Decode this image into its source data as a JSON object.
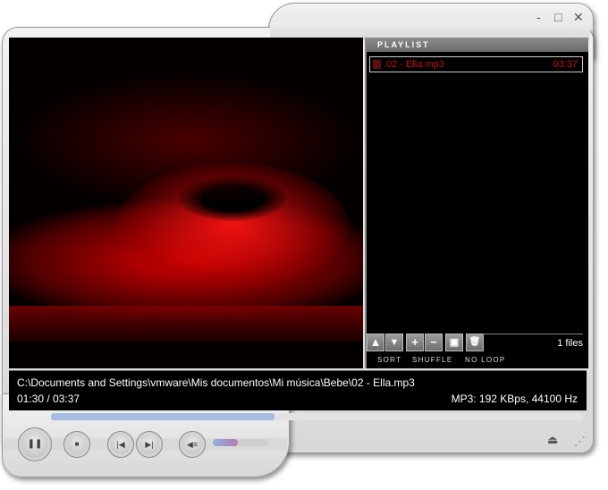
{
  "window": {
    "minimize_icon": "-",
    "maximize_icon": "□",
    "close_icon": "✕"
  },
  "playlist": {
    "title": "PLAYLIST",
    "items": [
      {
        "name": "02 - Ella.mp3",
        "duration": "03:37"
      }
    ],
    "toolbar": {
      "up": "▲",
      "down": "▼",
      "add": "+",
      "remove": "−",
      "screen": "▣",
      "trash": "🗑"
    },
    "file_count": "1 files",
    "sort": "SORT",
    "shuffle": "SHUFFLE",
    "loop": "NO LOOP"
  },
  "info": {
    "path": "C:\\Documents and Settings\\vmware\\Mis documentos\\Mi música\\Bebe\\02 - Ella.mp3",
    "time": "01:30 / 03:37",
    "format": "MP3: 192 KBps, 44100 Hz"
  },
  "progress": {
    "fraction": 0.42
  },
  "volume": {
    "fraction": 0.45
  },
  "controls": {
    "pause": "❚❚",
    "stop": "■",
    "prev": "|◀",
    "next": "▶|",
    "mute": "◀≡",
    "eject": "⏏",
    "grip": "⋰"
  }
}
